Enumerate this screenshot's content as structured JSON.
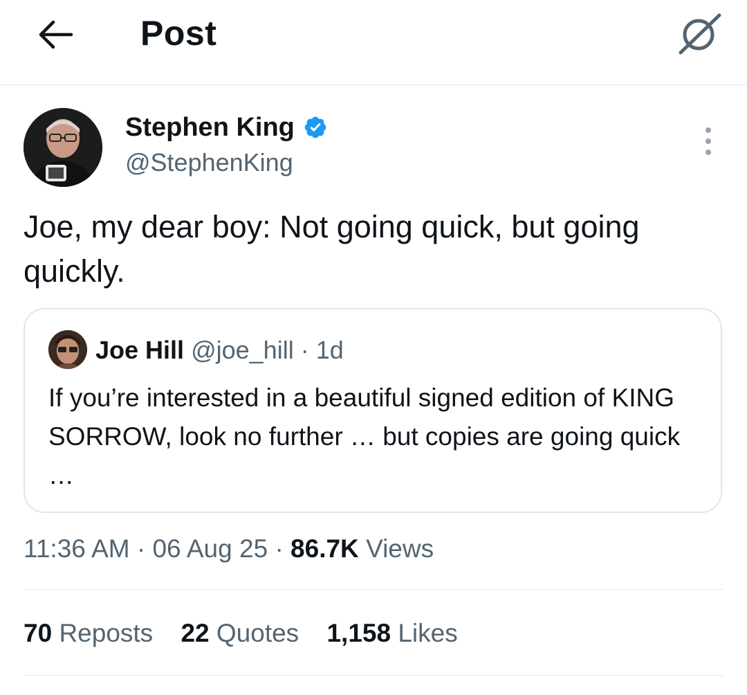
{
  "header": {
    "title": "Post",
    "back_icon": "arrow-left-icon",
    "grok_icon": "grok-icon"
  },
  "post": {
    "author": {
      "name": "Stephen King",
      "handle": "@StephenKing",
      "verified": true,
      "verified_color": "#1d9bf0"
    },
    "text": "Joe, my dear boy: Not going quick, but going quickly.",
    "quote": {
      "name": "Joe Hill",
      "handle": "@joe_hill",
      "separator": "·",
      "age": "1d",
      "text": "If you’re interested in a beautiful signed edition of KING SORROW, look no further … but copies are going quick …"
    },
    "meta": {
      "time": "11:36 AM",
      "sep1": "·",
      "date": "06 Aug 25",
      "sep2": "·",
      "views_count": "86.7K",
      "views_label": "Views"
    },
    "stats": {
      "reposts_count": "70",
      "reposts_label": "Reposts",
      "quotes_count": "22",
      "quotes_label": "Quotes",
      "likes_count": "1,158",
      "likes_label": "Likes"
    }
  },
  "colors": {
    "text_primary": "#0f1419",
    "text_secondary": "#536471",
    "border": "#e5e7e9",
    "accent": "#1d9bf0"
  }
}
